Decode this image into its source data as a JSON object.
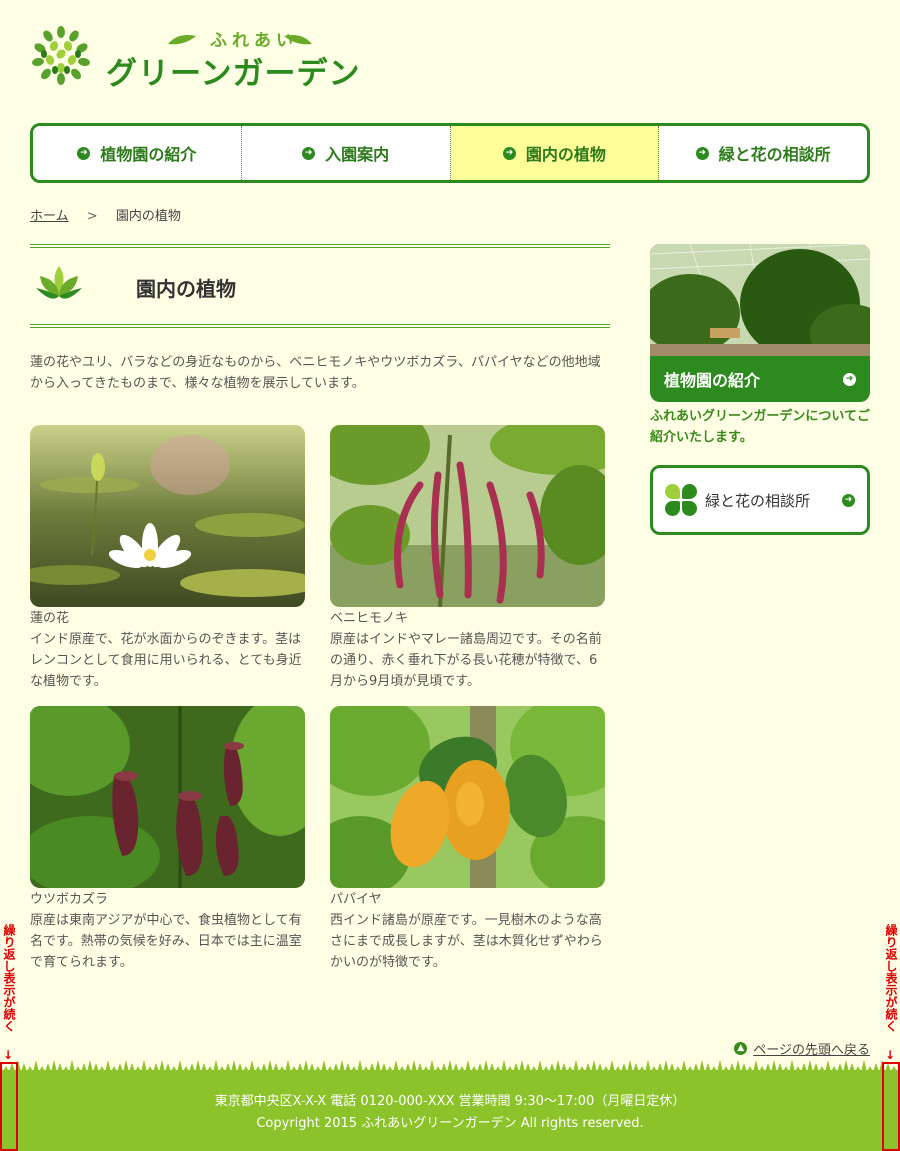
{
  "site": {
    "logo_sub": "ふれあい",
    "logo_main": "グリーンガーデン"
  },
  "nav": {
    "items": [
      {
        "label": "植物園の紹介"
      },
      {
        "label": "入園案内"
      },
      {
        "label": "園内の植物"
      },
      {
        "label": "緑と花の相談所"
      }
    ],
    "active_index": 2
  },
  "breadcrumb": {
    "home": "ホーム",
    "separator": ">",
    "current": "園内の植物"
  },
  "page": {
    "title": "園内の植物",
    "intro": "蓮の花やユリ、バラなどの身近なものから、ベニヒモノキやウツボカズラ、パパイヤなどの他地域から入ってきたものまで、様々な植物を展示しています。"
  },
  "plants": [
    {
      "name": "蓮の花",
      "desc": "インド原産で、花が水面からのぞきます。茎はレンコンとして食用に用いられる、とても身近な植物です。"
    },
    {
      "name": "ベニヒモノキ",
      "desc": "原産はインドやマレー諸島周辺です。その名前の通り、赤く垂れ下がる長い花穂が特徴で、6月から9月頃が見頃です。"
    },
    {
      "name": "ウツボカズラ",
      "desc": "原産は東南アジアが中心で、食虫植物として有名です。熱帯の気候を好み、日本では主に温室で育てられます。"
    },
    {
      "name": "パパイヤ",
      "desc": "西インド諸島が原産です。一見樹木のような高さにまで成長しますが、茎は木質化せずやわらかいのが特徴です。"
    }
  ],
  "sidebar": {
    "card_label": "植物園の紹介",
    "card_text": "ふれあいグリーンガーデンについてご紹介いたします。",
    "consult_label": "緑と花の相談所"
  },
  "pagetop": "ページの先頭へ戻る",
  "footer": {
    "address": "東京都中央区X-X-X 電話 0120-000-XXX 営業時間 9:30〜17:00（月曜日定休）",
    "copyright": "Copyright 2015 ふれあいグリーンガーデン All rights reserved."
  },
  "annotation": {
    "repeat_text": "繰り返し表示が続く",
    "arrow": "↓"
  },
  "colors": {
    "background": "#ffffe6",
    "primary_green": "#2c8a1e",
    "active_nav": "#ffff99",
    "footer_green": "#8cc22a",
    "annotation_red": "#dd0000"
  }
}
